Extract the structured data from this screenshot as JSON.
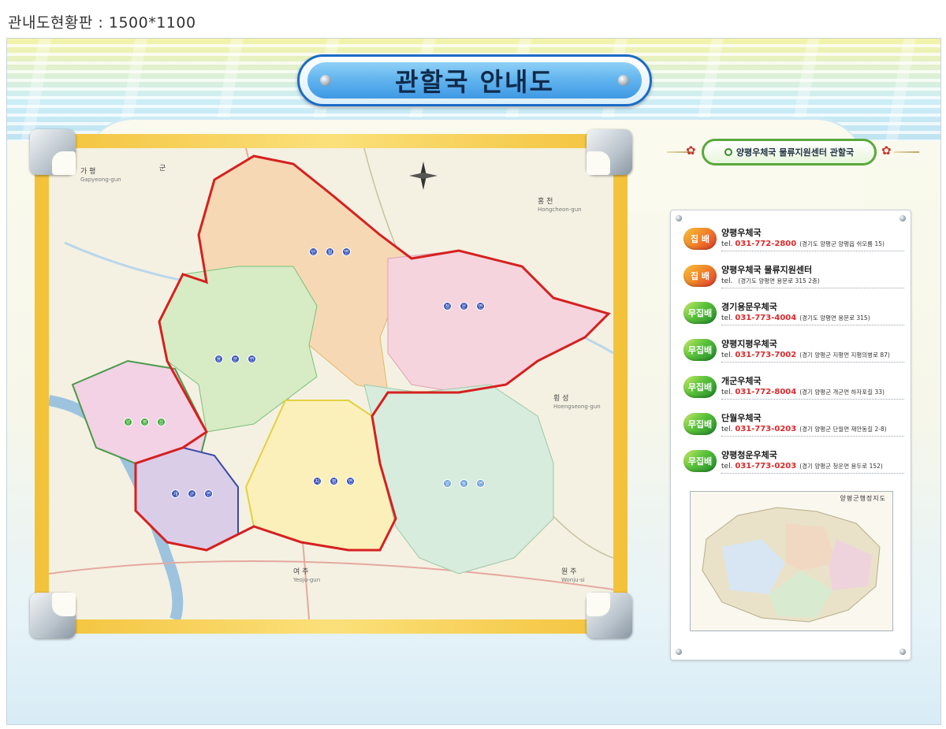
{
  "caption": "관내도현황판 : 1500*1100",
  "title": "관할국 안내도",
  "right_header": "양평우체국 물류지원센터 관할국",
  "offices": [
    {
      "badge": "집 배",
      "badge_color": "orange",
      "name": "양평우체국",
      "tel_label": "tel.",
      "tel": "031-772-2800",
      "address": "(경기도 양평군 양평읍 쉬오름 15)"
    },
    {
      "badge": "집 배",
      "badge_color": "orange",
      "name": "양평우체국 물류지원센터",
      "tel_label": "tel.",
      "tel": "",
      "address": "(경기도 양평면 용문로 315 2층)"
    },
    {
      "badge": "무집배",
      "badge_color": "green",
      "name": "경기용문우체국",
      "tel_label": "tel.",
      "tel": "031-773-4004",
      "address": "(경기도 양평면 용문로 315)"
    },
    {
      "badge": "무집배",
      "badge_color": "green",
      "name": "양평지평우체국",
      "tel_label": "tel.",
      "tel": "031-773-7002",
      "address": "(경기 양평군 지평면 지평의병로 87)"
    },
    {
      "badge": "무집배",
      "badge_color": "green",
      "name": "개군우체국",
      "tel_label": "tel.",
      "tel": "031-772-8004",
      "address": "(경기 양평군 개군면 하자포길 33)"
    },
    {
      "badge": "무집배",
      "badge_color": "green",
      "name": "단월우체국",
      "tel_label": "tel.",
      "tel": "031-773-0203",
      "address": "(경기 양평군 단월면 재안동길 2-8)"
    },
    {
      "badge": "무집배",
      "badge_color": "green",
      "name": "양평청운우체국",
      "tel_label": "tel.",
      "tel": "031-773-0203",
      "address": "(경기 양평군 청운면 용두로 152)"
    }
  ],
  "mini_map_title": "양평군행정지도",
  "map_labels": {
    "gapyeong": "가 평",
    "gapyeong_sub": "Gapyeong-gun",
    "hongcheon": "홍 천",
    "hongcheon_sub": "Hongcheon-gun",
    "hoengseong": "횡 성",
    "hoengseong_sub": "Hoengseong-gun",
    "yeoju": "여 주",
    "yeoju_sub": "Yeoju-gun",
    "wonju": "원 주",
    "wonju_sub": "Wonju-si",
    "gun": "군"
  },
  "towns": {
    "danwol": [
      "단",
      "월",
      "면"
    ],
    "cheongun": [
      "청",
      "운",
      "면"
    ],
    "yongmun": [
      "용",
      "문",
      "면"
    ],
    "yangpyeong": [
      "양",
      "평",
      "읍"
    ],
    "gaegun": [
      "개",
      "군",
      "면"
    ],
    "jipyeong": [
      "지",
      "평",
      "면"
    ],
    "yangdong": [
      "양",
      "동",
      "면"
    ]
  },
  "colors": {
    "boundary": "#d62020",
    "accent_blue": "#1a6cc6",
    "tel_red": "#e0282a",
    "badge_orange": "#f08a2a",
    "badge_green": "#3aa832"
  }
}
